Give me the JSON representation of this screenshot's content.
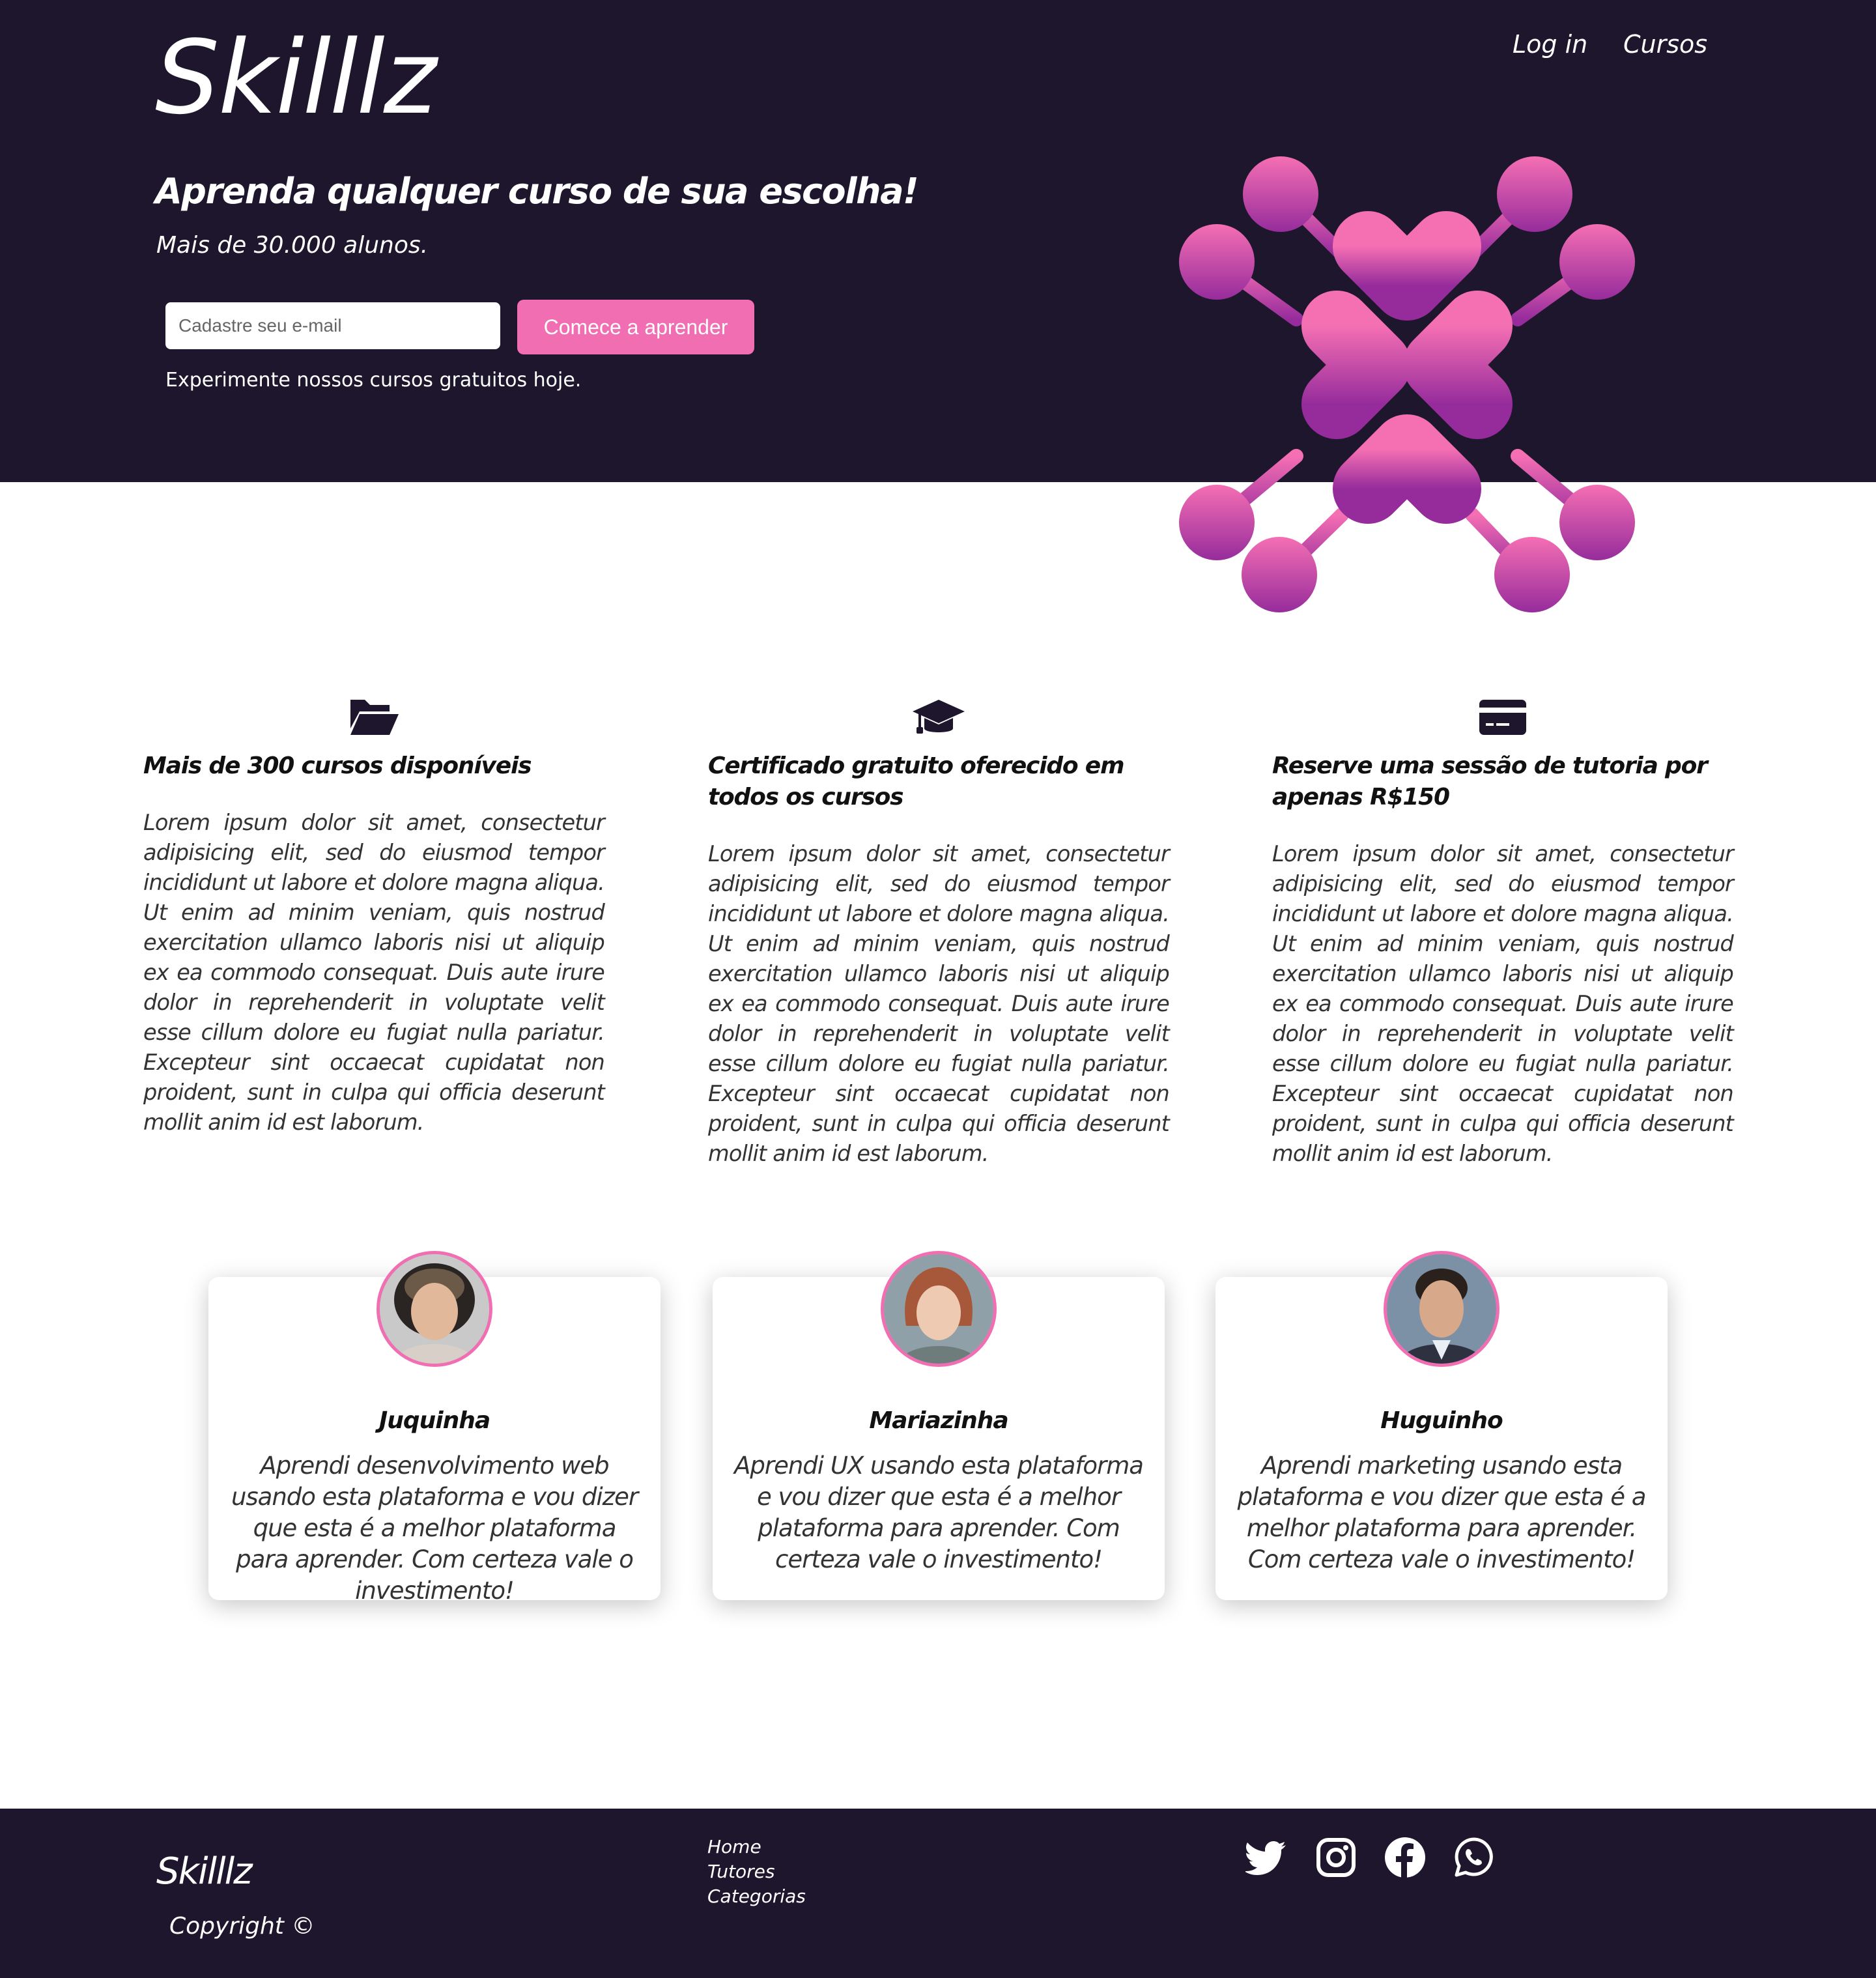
{
  "brand": {
    "name": "Skilllz"
  },
  "nav": {
    "login": "Log in",
    "courses": "Cursos"
  },
  "hero": {
    "title": "Aprenda qualquer curso de sua escolha!",
    "subtitle": "Mais de 30.000 alunos.",
    "email_placeholder": "Cadastre seu e-mail",
    "cta": "Comece a aprender",
    "note": "Experimente nossos cursos gratuitos hoje."
  },
  "features": [
    {
      "icon": "folder-open-icon",
      "title": "Mais de 300 cursos disponíveis",
      "text": "Lorem ipsum dolor sit amet, consectetur adipisicing elit, sed do eiusmod tempor incididunt ut labore et dolore magna aliqua. Ut enim ad minim veniam, quis nostrud exercitation ullamco laboris nisi ut aliquip ex ea commodo consequat. Duis aute irure dolor in reprehenderit in voluptate velit esse cillum dolore eu fugiat nulla pariatur. Excepteur sint occaecat cupidatat non proident, sunt in culpa qui officia deserunt mollit anim id est laborum."
    },
    {
      "icon": "graduation-cap-icon",
      "title": "Certificado gratuito oferecido em todos os cursos",
      "text": "Lorem ipsum dolor sit amet, consectetur adipisicing elit, sed do eiusmod tempor incididunt ut labore et dolore magna aliqua. Ut enim ad minim veniam, quis nostrud exercitation ullamco laboris nisi ut aliquip ex ea commodo consequat. Duis aute irure dolor in reprehenderit in voluptate velit esse cillum dolore eu fugiat nulla pariatur. Excepteur sint occaecat cupidatat non proident, sunt in culpa qui officia deserunt mollit anim id est laborum."
    },
    {
      "icon": "credit-card-icon",
      "title": "Reserve uma sessão de tutoria por apenas R$150",
      "text": "Lorem ipsum dolor sit amet, consectetur adipisicing elit, sed do eiusmod tempor incididunt ut labore et dolore magna aliqua. Ut enim ad minim veniam, quis nostrud exercitation ullamco laboris nisi ut aliquip ex ea commodo consequat. Duis aute irure dolor in reprehenderit in voluptate velit esse cillum dolore eu fugiat nulla pariatur. Excepteur sint occaecat cupidatat non proident, sunt in culpa qui officia deserunt mollit anim id est laborum."
    }
  ],
  "testimonials": [
    {
      "name": "Juquinha",
      "text": "Aprendi desenvolvimento web usando esta plataforma e vou dizer que esta é a melhor plataforma para aprender. Com certeza vale o investimento!"
    },
    {
      "name": "Mariazinha",
      "text": "Aprendi UX usando esta plataforma e vou dizer que esta é a melhor plataforma para aprender. Com certeza vale o investimento!"
    },
    {
      "name": "Huguinho",
      "text": "Aprendi marketing usando esta plataforma e vou dizer que esta é a melhor plataforma para aprender. Com certeza vale o investimento!"
    }
  ],
  "footer": {
    "brand": "Skilllz",
    "copyright": "Copyright ©",
    "links": [
      "Home",
      "Tutores",
      "Categorias"
    ],
    "social": [
      "twitter-icon",
      "instagram-icon",
      "facebook-icon",
      "whatsapp-icon"
    ]
  },
  "colors": {
    "dark": "#1e162c",
    "accent": "#f06eb1",
    "gradient_end": "#962c9c"
  }
}
